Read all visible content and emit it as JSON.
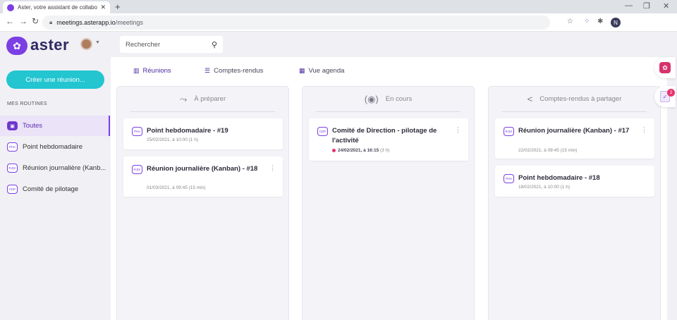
{
  "browser": {
    "tab_title": "Aster, votre assistant de collabor",
    "url_host": "meetings.asterapp.io",
    "url_path": "/meetings",
    "profile_initial": "N"
  },
  "app": {
    "logo_text": "aster",
    "search_placeholder": "Rechercher",
    "create_button": "Créer une réunion...",
    "accent_color": "#7b3fe4",
    "cta_color": "#22c5d0"
  },
  "sidebar": {
    "section_title": "MES ROUTINES",
    "items": [
      {
        "label": "Toutes",
        "code": "▣",
        "active": true
      },
      {
        "label": "Point hebdomadaire",
        "code": "PHe"
      },
      {
        "label": "Réunion journalière (Kanb...",
        "code": "RJ(K"
      },
      {
        "label": "Comité de pilotage",
        "code": "CDP"
      }
    ]
  },
  "tabs": [
    {
      "label": "Réunions",
      "icon": "columns-icon",
      "active": true
    },
    {
      "label": "Comptes-rendus",
      "icon": "list-icon"
    },
    {
      "label": "Vue agenda",
      "icon": "calendar-icon"
    }
  ],
  "columns": [
    {
      "title": "À préparer",
      "icon": "share-forward-icon",
      "cards": [
        {
          "code": "PHe",
          "title": "Point hebdomadaire - #19",
          "date": "25/02/2021, à 10:00 (1 h)"
        },
        {
          "code": "RJ(K",
          "title": "Réunion journalière (Kanban) - #18",
          "date": "01/03/2021, à 09:45 (15 min)"
        }
      ]
    },
    {
      "title": "En cours",
      "icon": "live-icon",
      "cards": [
        {
          "code": "CDP",
          "title": "Comité de Direction - pilotage de l'activité",
          "date_highlight": "24/02/2021, à 16:15",
          "date_rest": " (3 h)"
        }
      ]
    },
    {
      "title": "Comptes-rendus à partager",
      "icon": "share-icon",
      "cards": [
        {
          "code": "RJ(K",
          "title": "Réunion journalière (Kanban) - #17",
          "date": "22/02/2021, à 09:45 (15 min)"
        },
        {
          "code": "PHe",
          "title": "Point hebdomadaire - #18",
          "date": "18/02/2021, à 10:00 (1 h)"
        }
      ]
    }
  ],
  "widgets": {
    "tasks_badge": "2"
  }
}
